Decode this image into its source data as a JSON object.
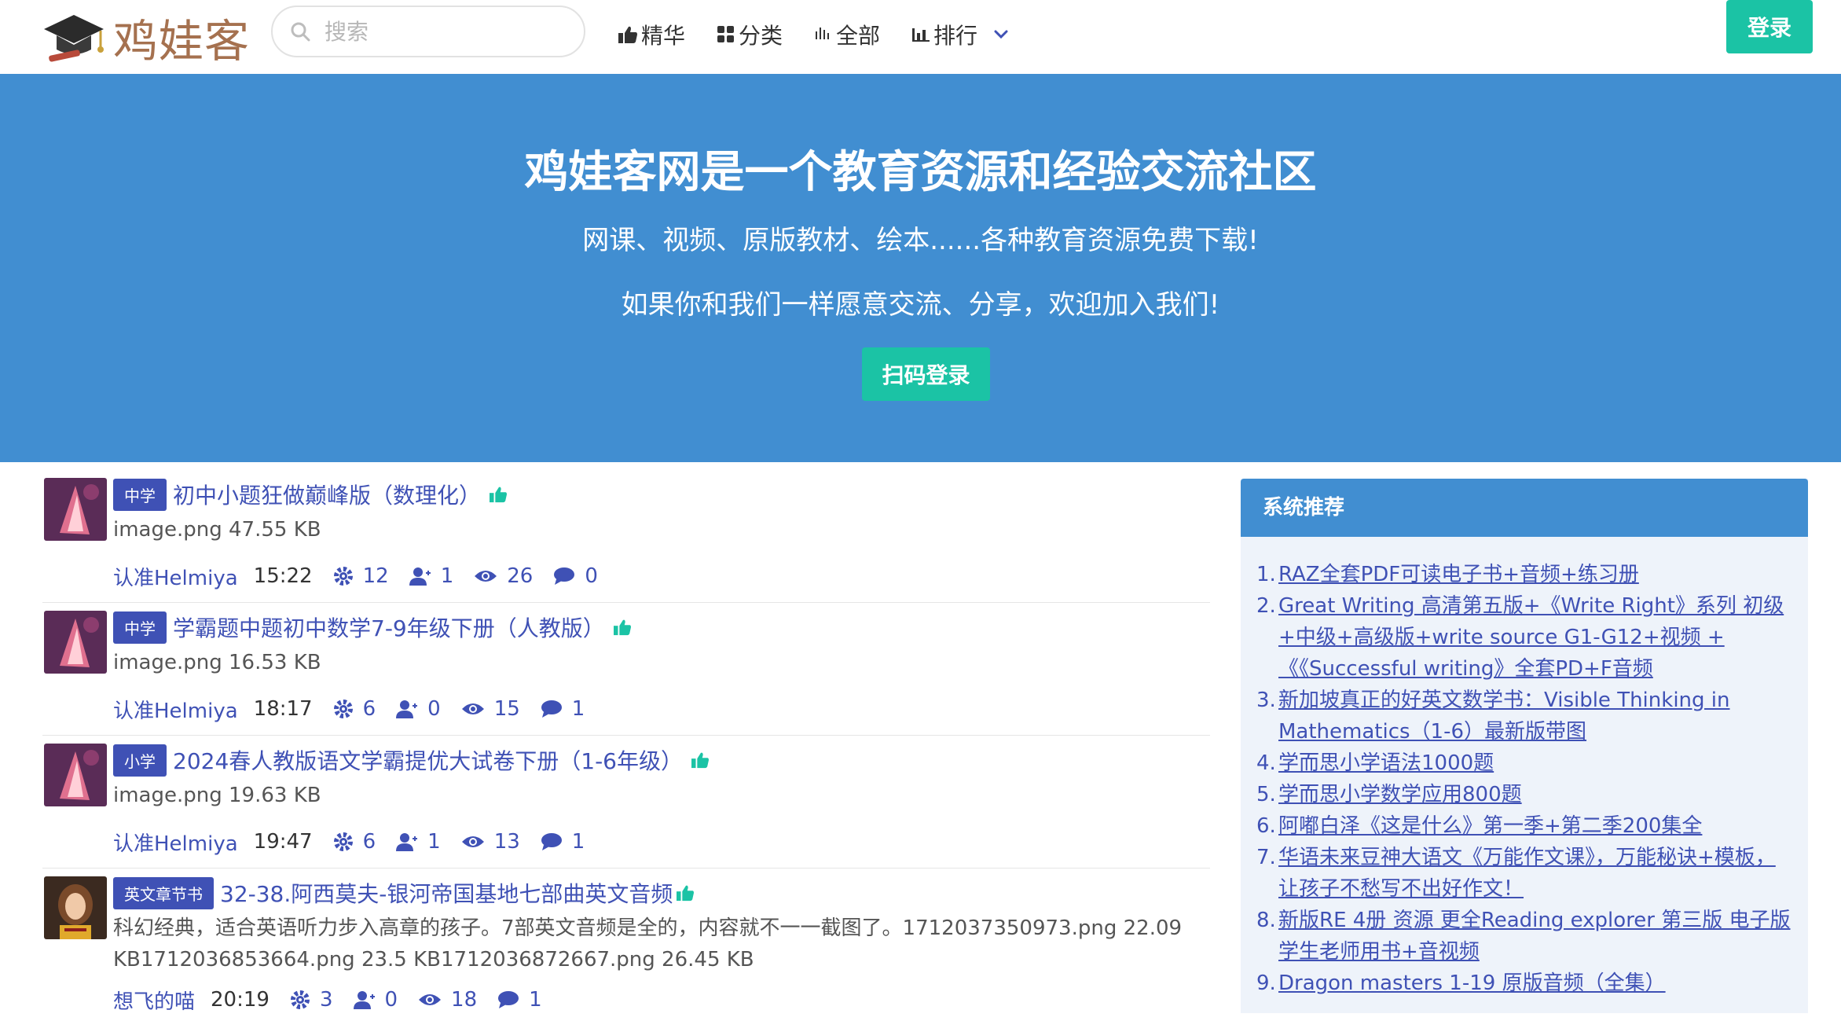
{
  "header": {
    "logo_text": "鸡娃客",
    "search_placeholder": "搜索",
    "nav": [
      {
        "label": "精华",
        "icon": "thumbs-up-icon"
      },
      {
        "label": "分类",
        "icon": "grid-icon"
      },
      {
        "label": "全部",
        "icon": "bars-icon"
      },
      {
        "label": "排行",
        "icon": "bar-chart-icon"
      }
    ],
    "login_label": "登录"
  },
  "hero": {
    "title": "鸡娃客网是一个教育资源和经验交流社区",
    "subtitle1": "网课、视频、原版教材、绘本......各种教育资源免费下载!",
    "subtitle2": "如果你和我们一样愿意交流、分享，欢迎加入我们!",
    "qr_login_label": "扫码登录"
  },
  "posts": [
    {
      "tag": "中学",
      "title": "初中小题狂做巅峰版（数理化）",
      "desc": "image.png 47.55 KB",
      "author": "认准Helmiya",
      "time": "15:22",
      "likes": "12",
      "followers": "1",
      "views": "26",
      "comments": "0"
    },
    {
      "tag": "中学",
      "title": "学霸题中题初中数学7-9年级下册（人教版）",
      "desc": "image.png 16.53 KB",
      "author": "认准Helmiya",
      "time": "18:17",
      "likes": "6",
      "followers": "0",
      "views": "15",
      "comments": "1"
    },
    {
      "tag": "小学",
      "title": "2024春人教版语文学霸提优大试卷下册（1-6年级）",
      "desc": "image.png 19.63 KB",
      "author": "认准Helmiya",
      "time": "19:47",
      "likes": "6",
      "followers": "1",
      "views": "13",
      "comments": "1"
    },
    {
      "tag": "英文章节书",
      "title": "32-38.阿西莫夫-银河帝国基地七部曲英文音频",
      "desc": "科幻经典，适合英语听力步入高章的孩子。7部英文音频是全的，内容就不一一截图了。1712037350973.png 22.09 KB1712036853664.png 23.5 KB1712036872667.png 26.45 KB",
      "author": "想飞的喵",
      "time": "20:19",
      "likes": "3",
      "followers": "0",
      "views": "18",
      "comments": "1"
    }
  ],
  "sidebar": {
    "title": "系统推荐",
    "items": [
      "RAZ全套PDF可读电子书+音频+练习册",
      "Great Writing 高清第五版+《Write Right》系列 初级+中级+高级版+write source G1-G12+视频 +《《Successful writing》全套PD+F音频",
      "新加坡真正的好英文数学书：Visible Thinking in Mathematics（1-6）最新版带图",
      "学而思小学语法1000题",
      "学而思小学数学应用800题",
      "阿嘟白泽《这是什么》第一季+第二季200集全",
      "华语未来豆神大语文《万能作文课》，万能秘诀+模板，让孩子不愁写不出好作文！",
      "新版RE 4册 资源 更全Reading explorer 第三版 电子版 学生老师用书+音视频",
      "Dragon masters 1-19 原版音频（全集）"
    ]
  },
  "colors": {
    "accent": "#1bc3a5",
    "hero_bg": "#418ed1",
    "link": "#3f51b5",
    "brand": "#a5714f"
  }
}
